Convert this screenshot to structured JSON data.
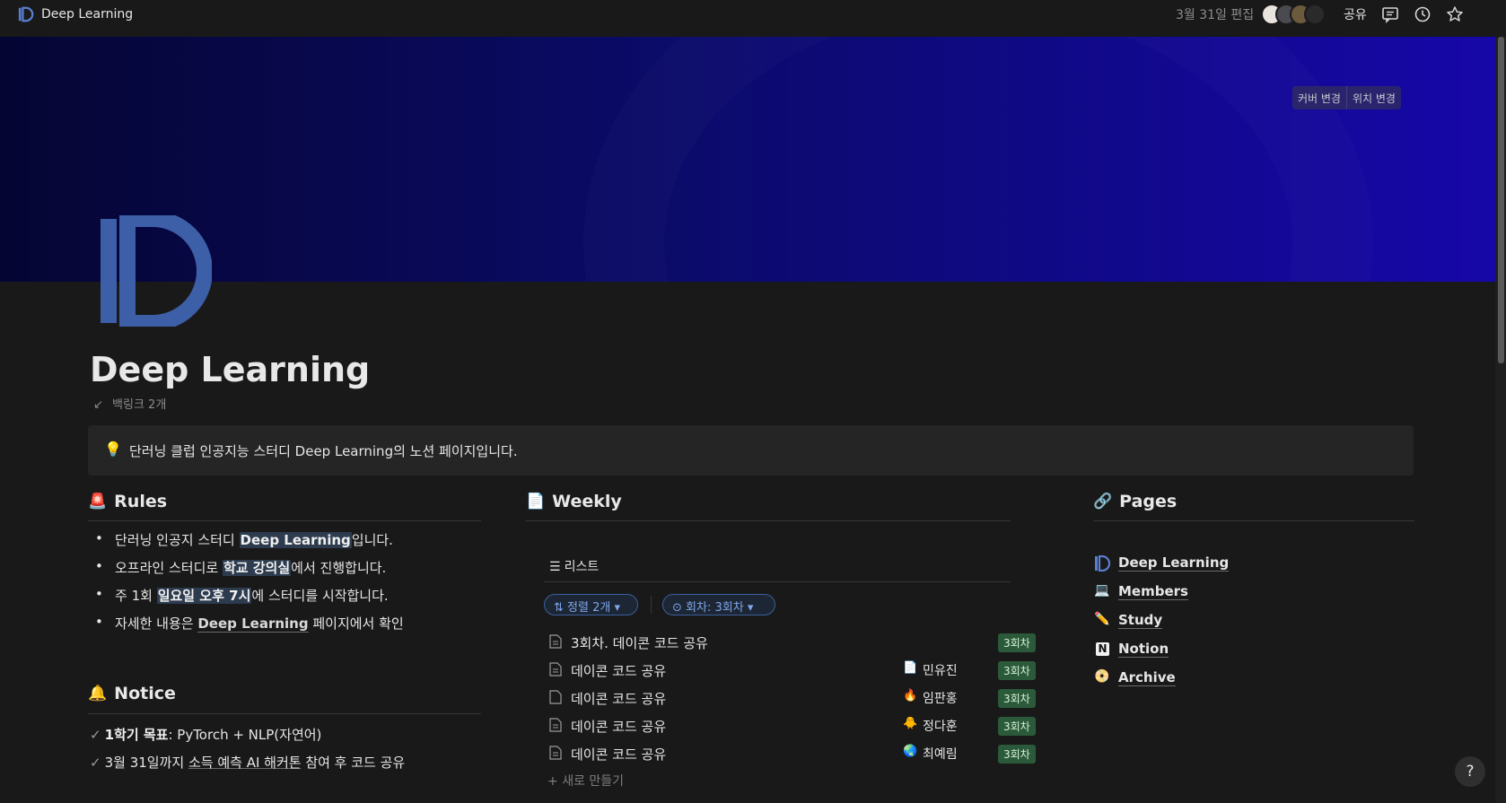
{
  "topbar": {
    "title": "Deep Learning",
    "edited": "3월 31일 편집",
    "share": "공유",
    "icons": [
      "comment-icon",
      "history-icon",
      "star-icon"
    ]
  },
  "cover": {
    "change_cover": "커버 변경",
    "reposition": "위치 변경",
    "colors": [
      "#050533",
      "#0b0b6a",
      "#1607a8"
    ]
  },
  "page": {
    "title": "Deep Learning",
    "backlinks": "백링크 2개",
    "icon_color": "#3c5fa8"
  },
  "callout": {
    "icon": "bulb-icon",
    "text": "단러닝 클럽 인공지능 스터디 Deep Learning의 노션 페이지입니다."
  },
  "rules": {
    "heading": "Rules",
    "icon": "siren-icon",
    "items": [
      {
        "before": "단러닝 인공지 스터디 ",
        "hl": "Deep Learning",
        "after": "입니다."
      },
      {
        "before": "오프라인 스터디로 ",
        "hl": "학교 강의실",
        "after": "에서 진행합니다."
      },
      {
        "before": "주 1회 ",
        "hl": "일요일  오후 7시",
        "after": "에 스터디를 시작합니다."
      },
      {
        "before": "자세한 내용은  ",
        "link": "Deep Learning",
        "after": " 페이지에서 확인"
      }
    ]
  },
  "notice": {
    "heading": "Notice",
    "icon": "bell-icon",
    "items": [
      {
        "bold": "1학기 목표",
        "text": ": PyTorch + NLP(자연어)"
      },
      {
        "pre": "3월 31일까지 ",
        "u": "소득 예측 AI 해커톤",
        "post": " 참여 후 코드 공유"
      }
    ]
  },
  "weekly": {
    "heading": "Weekly",
    "icon": "page-icon",
    "view": "리스트",
    "sort": "정렬 2개",
    "filter": "회차: 3회차",
    "rows": [
      {
        "name": "3회차. 데이콘 코드 공유",
        "person": "",
        "person_icon": "",
        "tag": "3회차"
      },
      {
        "name": "데이콘 코드 공유",
        "person": "민유진",
        "person_icon": "📄",
        "tag": "3회차"
      },
      {
        "name": "데이콘 코드 공유",
        "person": "임판홍",
        "person_icon": "🔥",
        "tag": "3회차"
      },
      {
        "name": "데이콘 코드 공유",
        "person": "정다훈",
        "person_icon": "🐥",
        "tag": "3회차"
      },
      {
        "name": "데이콘 코드 공유",
        "person": "최예림",
        "person_icon": "🌏",
        "tag": "3회차"
      }
    ],
    "new": "새로 만들기",
    "tag_color": "#2b5a3a"
  },
  "pages": {
    "heading": "Pages",
    "icon": "link-icon",
    "items": [
      {
        "label": "Deep Learning",
        "icon": "deep-learning-logo-icon"
      },
      {
        "label": "Members",
        "icon": "laptop-icon"
      },
      {
        "label": "Study",
        "icon": "pen-icon"
      },
      {
        "label": "Notion",
        "icon": "notion-icon"
      },
      {
        "label": "Archive",
        "icon": "disc-icon"
      }
    ]
  },
  "help": "?"
}
